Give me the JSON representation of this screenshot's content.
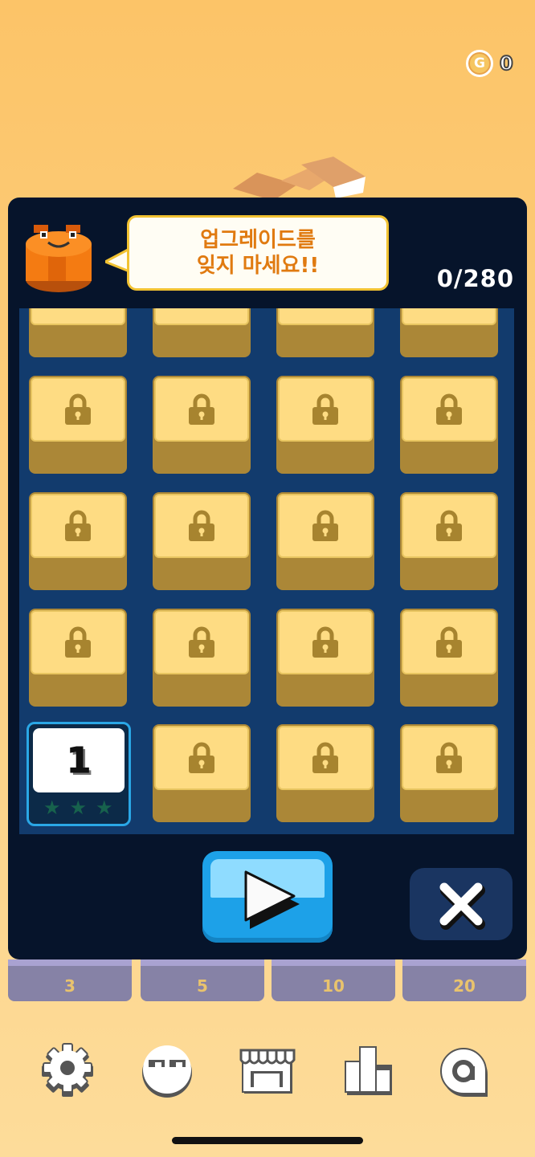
{
  "hud": {
    "coin_symbol": "G",
    "coin_count": "0"
  },
  "dialog": {
    "speech_line1": "업그레이드를",
    "speech_line2": "잊지 마세요!!",
    "progress": "0/280"
  },
  "levels": {
    "unlocked_level": "1",
    "stars_earned": 0,
    "stars_total": 3
  },
  "buttons": {
    "play_icon": "play-icon",
    "close_icon": "close-icon"
  },
  "tabs": [
    "3",
    "5",
    "10",
    "20"
  ],
  "bottom_nav": [
    "gear-icon",
    "character-icon",
    "shop-icon",
    "leaderboard-icon",
    "more-icon"
  ],
  "colors": {
    "accent": "#1da1e8",
    "panel": "#06142b",
    "grid": "#123b6d",
    "tile_face": "#fedc83",
    "tile_side": "#ab8737",
    "speech_text": "#e07a10"
  }
}
